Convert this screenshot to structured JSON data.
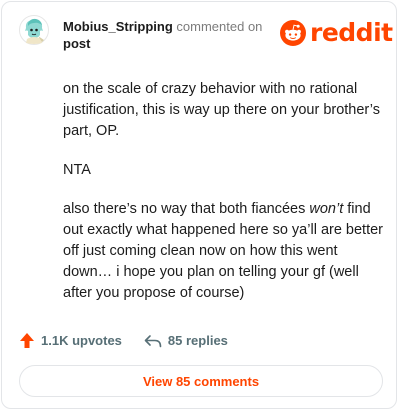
{
  "comment": {
    "username": "Mobius_Stripping",
    "action_text": "commented on",
    "post_link_label": "post",
    "paragraphs": {
      "p1": "on the scale of crazy behavior with no rational justification, this is way up there on your brother’s part, OP.",
      "p2": "NTA",
      "p3_before": "also there’s no way that both fiancées ",
      "p3_emph": "won’t",
      "p3_after": " find out exactly what happened here so ya’ll are better off just coming clean now on how this went down… i hope you plan on telling your gf (well after you propose of course)"
    }
  },
  "brand": {
    "name": "reddit",
    "color": "#ff4500",
    "icon": "reddit-alien-icon"
  },
  "stats": {
    "upvotes": "1.1K upvotes",
    "upvote_icon": "upvote-arrow-icon",
    "upvote_color": "#ff4500",
    "replies": "85 replies",
    "reply_icon": "reply-arrow-icon"
  },
  "footer": {
    "view_comments_label": "View 85 comments"
  }
}
